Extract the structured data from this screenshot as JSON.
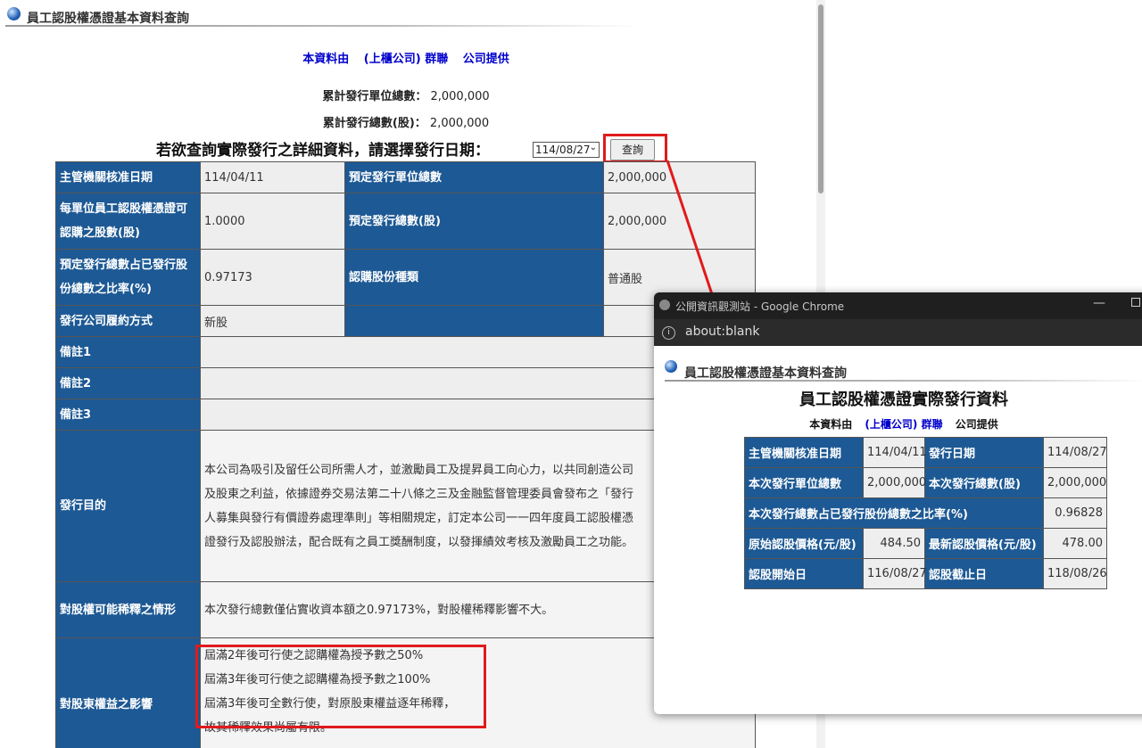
{
  "main": {
    "header_title": "員工認股權憑證基本資料查詢",
    "provider": {
      "part1": "本資料由",
      "part2": "(上櫃公司) 群聯",
      "part3": "公司提供"
    },
    "summary": [
      {
        "label": "累計發行單位總數：",
        "value": "2,000,000"
      },
      {
        "label": "累計發行總數(股)：",
        "value": "2,000,000"
      }
    ],
    "query_prompt": "若欲查詢實際發行之詳細資料，請選擇發行日期：",
    "query_date": "114/08/27",
    "query_button": "查詢",
    "table": {
      "approval_date_label": "主管機關核准日期",
      "approval_date": "114/04/11",
      "planned_units_label": "預定發行單位總數",
      "planned_units": "2,000,000",
      "shares_per_unit_label": "每單位員工認股權憑證可認購之股數(股)",
      "shares_per_unit": "1.0000",
      "planned_shares_label": "預定發行總數(股)",
      "planned_shares": "2,000,000",
      "ratio_label": "預定發行總數占已發行股份總數之比率(%)",
      "ratio": "0.97173",
      "share_type_label": "認購股份種類",
      "share_type": "普通股",
      "fulfillment_label": "發行公司履約方式",
      "fulfillment": "新股",
      "note1_label": "備註1",
      "note2_label": "備註2",
      "note3_label": "備註3",
      "purpose_label": "發行目的",
      "purpose": "本公司為吸引及留任公司所需人才，並激勵員工及提昇員工向心力，以共同創造公司及股東之利益，依據證券交易法第二十八條之三及金融監督管理委員會發布之「發行人募集與發行有價證券處理準則」等相關規定，訂定本公司一一四年度員工認股權憑證發行及認股辦法，配合既有之員工獎酬制度，以發揮績效考核及激勵員工之功能。",
      "dilution_label": "對股權可能稀釋之情形",
      "dilution": "本次發行總數僅佔實收資本額之0.97173%，對股權稀釋影響不大。",
      "impact_label": "對股東權益之影響",
      "impact_lines": [
        "屆滿2年後可行使之認購權為授予數之50%",
        "屆滿3年後可行使之認購權為授予數之100%",
        "屆滿3年後可全數行使，對原股東權益逐年稀釋，",
        "故其稀釋效果尚屬有限。"
      ]
    }
  },
  "popup": {
    "window_title": "公開資訊觀測站 - Google Chrome",
    "minimize_glyph": "—",
    "url": "about:blank",
    "header_title": "員工認股權憑證基本資料查詢",
    "big_title": "員工認股權憑證實際發行資料",
    "provider": {
      "part1": "本資料由",
      "part2": "(上櫃公司) 群聯",
      "part3": "公司提供"
    },
    "table": {
      "approval_date_label": "主管機關核准日期",
      "approval_date": "114/04/11",
      "issue_date_label": "發行日期",
      "issue_date": "114/08/27",
      "units_label": "本次發行單位總數",
      "units": "2,000,000",
      "shares_label": "本次發行總數(股)",
      "shares": "2,000,000",
      "ratio_label": "本次發行總數占已發行股份總數之比率(%)",
      "ratio": "0.96828",
      "orig_price_label": "原始認股價格(元/股)",
      "orig_price": "484.50",
      "latest_price_label": "最新認股價格(元/股)",
      "latest_price": "478.00",
      "start_label": "認股開始日",
      "start": "116/08/27",
      "end_label": "認股截止日",
      "end": "118/08/26"
    }
  },
  "colors": {
    "header_cell": "#1d5994",
    "annotation_red": "#e01b1b",
    "provider_blue": "#0000cc"
  },
  "icons": [
    "globe-icon",
    "info-icon",
    "dropdown-arrow-icon"
  ]
}
